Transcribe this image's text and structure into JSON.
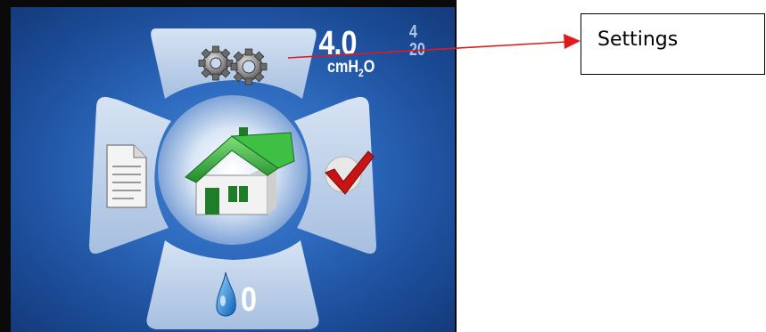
{
  "screen": {
    "pressure_value": "4.0",
    "pressure_unit_main": "cmH",
    "pressure_unit_sub": "2",
    "pressure_unit_end": "O",
    "side_values": [
      "4",
      "20"
    ],
    "humidity_value": "0"
  },
  "menu": {
    "top": {
      "icon": "gears-icon"
    },
    "left": {
      "icon": "document-icon"
    },
    "center": {
      "icon": "home-icon"
    },
    "right": {
      "icon": "checkmark-icon"
    },
    "bottom": {
      "icon": "water-drop-icon"
    }
  },
  "annotation": {
    "label": "Settings",
    "arrow_color": "#e01b1b"
  },
  "colors": {
    "screen_blue": "#2f6cc0",
    "panel": "#bcd0ea",
    "house_green": "#2faa2f"
  }
}
